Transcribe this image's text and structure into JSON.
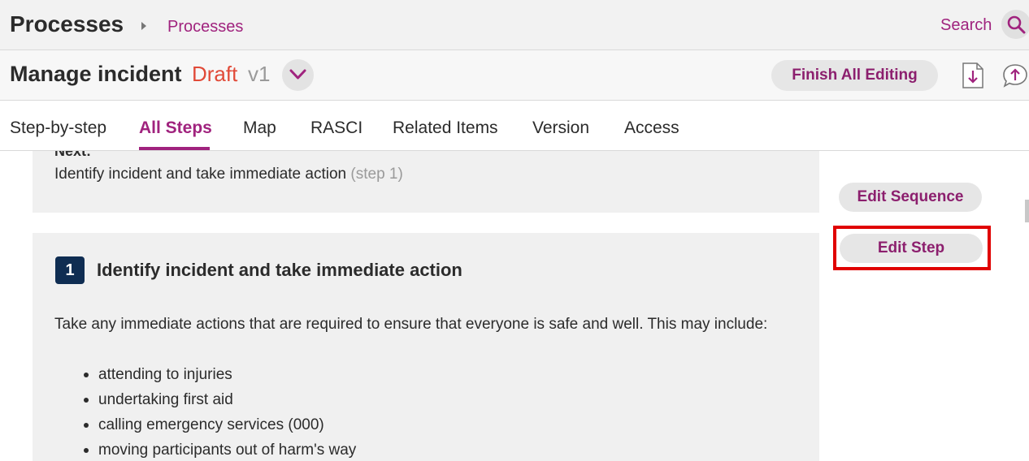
{
  "header": {
    "app_title": "Processes",
    "breadcrumb": "Processes",
    "search_label": "Search"
  },
  "process": {
    "title": "Manage incident",
    "status": "Draft",
    "version": "v1",
    "finish_label": "Finish All Editing"
  },
  "tabs": [
    {
      "label": "Step-by-step",
      "active": false
    },
    {
      "label": "All Steps",
      "active": true
    },
    {
      "label": "Map",
      "active": false
    },
    {
      "label": "RASCI",
      "active": false
    },
    {
      "label": "Related Items",
      "active": false
    },
    {
      "label": "Version",
      "active": false
    },
    {
      "label": "Access",
      "active": false
    }
  ],
  "next_card": {
    "heading": "Next:",
    "text": "Identify incident and take immediate action",
    "step_ref": "(step 1)"
  },
  "step": {
    "number": "1",
    "title": "Identify incident and take immediate action",
    "description": "Take any immediate actions that are required to ensure that everyone is safe and well. This may include:",
    "items": [
      "attending to injuries",
      "undertaking first aid",
      "calling emergency services (000)",
      "moving participants out of harm's way"
    ]
  },
  "actions": {
    "edit_sequence": "Edit Sequence",
    "edit_step": "Edit Step"
  },
  "colors": {
    "accent": "#a0237e",
    "draft": "#e14a38",
    "badge": "#0f2d52",
    "highlight": "#e00000"
  },
  "icons": {
    "search": "search-icon",
    "chevron": "chevron-down-icon",
    "download": "download-icon",
    "feedback": "feedback-upload-icon"
  }
}
